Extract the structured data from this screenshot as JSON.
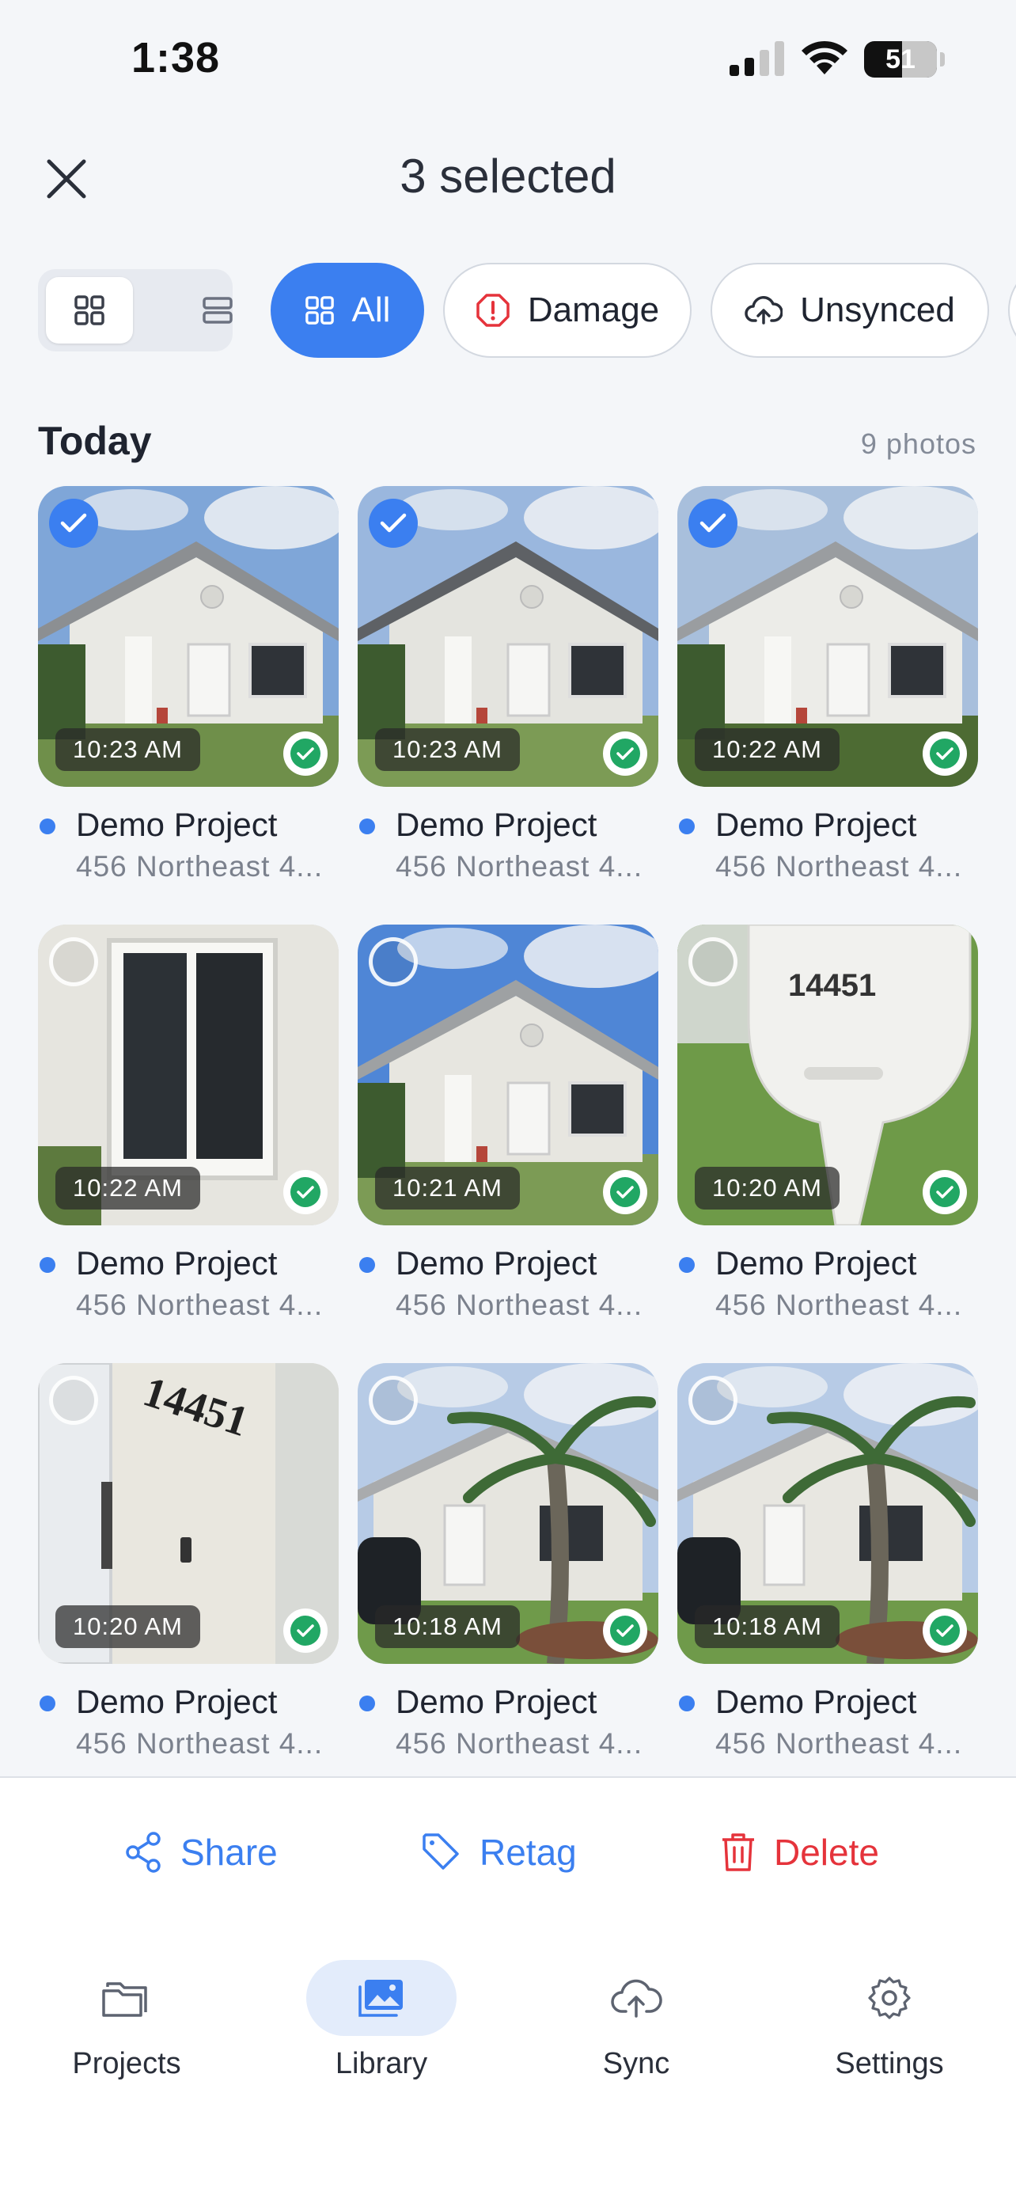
{
  "status_bar": {
    "time": "1:38",
    "battery": "51"
  },
  "header": {
    "title": "3 selected"
  },
  "view_toggle": {
    "selected": "grid"
  },
  "filters": [
    {
      "label": "All",
      "icon": "grid-icon",
      "active": true
    },
    {
      "label": "Damage",
      "icon": "alert-octagon-icon",
      "active": false
    },
    {
      "label": "Unsynced",
      "icon": "cloud-upload-icon",
      "active": false
    }
  ],
  "section": {
    "title": "Today",
    "count": "9 photos"
  },
  "photos": [
    {
      "time": "10:23 AM",
      "selected": true,
      "synced": true,
      "project": "Demo Project",
      "address": "456 Northeast 4..."
    },
    {
      "time": "10:23 AM",
      "selected": true,
      "synced": true,
      "project": "Demo Project",
      "address": "456 Northeast 4..."
    },
    {
      "time": "10:22 AM",
      "selected": true,
      "synced": true,
      "project": "Demo Project",
      "address": "456 Northeast 4..."
    },
    {
      "time": "10:22 AM",
      "selected": false,
      "synced": true,
      "project": "Demo Project",
      "address": "456 Northeast 4..."
    },
    {
      "time": "10:21 AM",
      "selected": false,
      "synced": true,
      "project": "Demo Project",
      "address": "456 Northeast 4..."
    },
    {
      "time": "10:20 AM",
      "selected": false,
      "synced": true,
      "project": "Demo Project",
      "address": "456 Northeast 4..."
    },
    {
      "time": "10:20 AM",
      "selected": false,
      "synced": true,
      "project": "Demo Project",
      "address": "456 Northeast 4..."
    },
    {
      "time": "10:18 AM",
      "selected": false,
      "synced": true,
      "project": "Demo Project",
      "address": "456 Northeast 4..."
    },
    {
      "time": "10:18 AM",
      "selected": false,
      "synced": true,
      "project": "Demo Project",
      "address": "456 Northeast 4..."
    }
  ],
  "actions": {
    "share": "Share",
    "retag": "Retag",
    "delete": "Delete"
  },
  "tabs": [
    {
      "label": "Projects",
      "icon": "folder-icon",
      "active": false
    },
    {
      "label": "Library",
      "icon": "images-icon",
      "active": true
    },
    {
      "label": "Sync",
      "icon": "cloud-upload-icon",
      "active": false
    },
    {
      "label": "Settings",
      "icon": "gear-icon",
      "active": false
    }
  ],
  "colors": {
    "accent": "#3b7ff0",
    "danger": "#e5333b",
    "synced": "#21a764"
  }
}
